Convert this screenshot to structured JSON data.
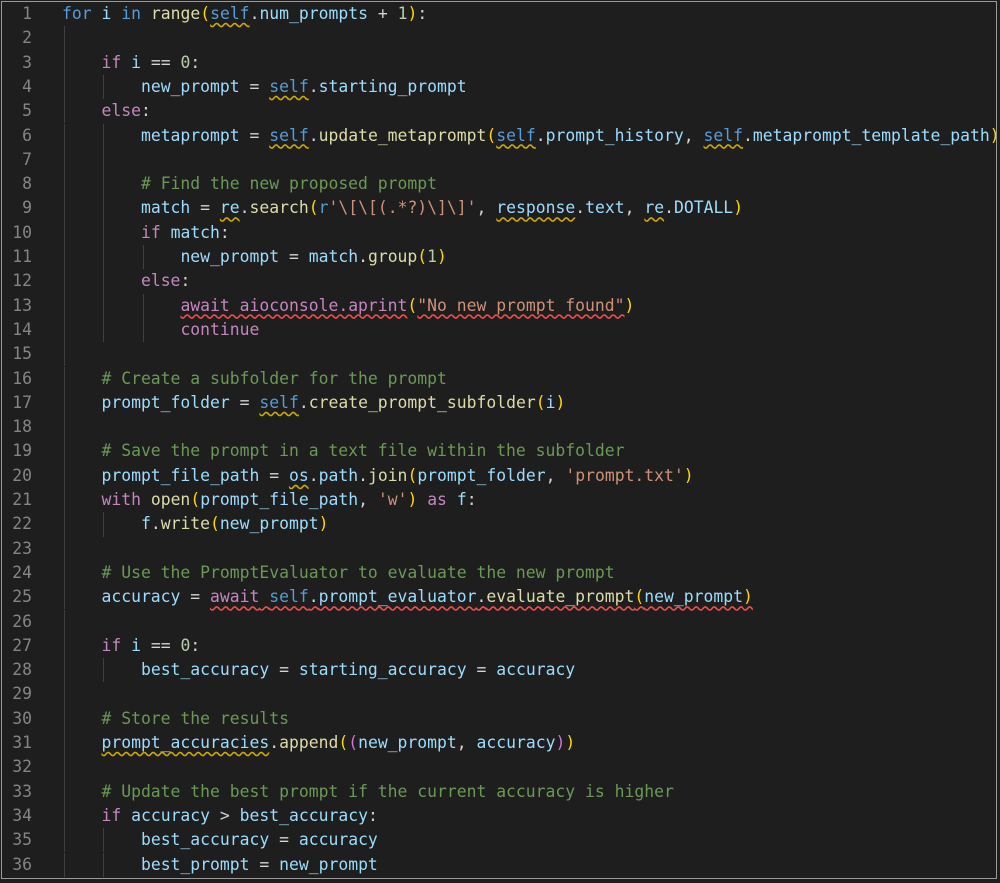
{
  "editor": {
    "theme": "dark",
    "line_count": 36,
    "colors": {
      "background": "#1e1e1e",
      "line_number": "#858585",
      "keyword": "#569cd6",
      "control": "#c586c0",
      "function": "#dcdcaa",
      "variable": "#9cdcfe",
      "string": "#ce9178",
      "number": "#b5cea8",
      "comment": "#6a9955",
      "bracket_1": "#ffd700",
      "bracket_2": "#da70d6",
      "bracket_3": "#179fff",
      "warning_squiggle": "#cca700",
      "error_squiggle": "#f14c4c"
    }
  },
  "lines": [
    {
      "n": "1",
      "indent": 0,
      "tokens": [
        [
          "kw",
          "for"
        ],
        [
          "op",
          " "
        ],
        [
          "vr",
          "i"
        ],
        [
          "op",
          " "
        ],
        [
          "kw",
          "in"
        ],
        [
          "op",
          " "
        ],
        [
          "fn",
          "range"
        ],
        [
          "b1",
          "("
        ],
        [
          "sf",
          "self",
          "sq-y"
        ],
        [
          "op",
          "."
        ],
        [
          "vr",
          "num_prompts"
        ],
        [
          "op",
          " + "
        ],
        [
          "num",
          "1"
        ],
        [
          "b1",
          ")"
        ],
        [
          "op",
          ":"
        ]
      ]
    },
    {
      "n": "2",
      "indent": 1,
      "tokens": []
    },
    {
      "n": "3",
      "indent": 1,
      "tokens": [
        [
          "ctl",
          "if"
        ],
        [
          "op",
          " "
        ],
        [
          "vr",
          "i"
        ],
        [
          "op",
          " == "
        ],
        [
          "num",
          "0"
        ],
        [
          "op",
          ":"
        ]
      ]
    },
    {
      "n": "4",
      "indent": 2,
      "tokens": [
        [
          "vr",
          "new_prompt"
        ],
        [
          "op",
          " = "
        ],
        [
          "sf",
          "self",
          "sq-y"
        ],
        [
          "op",
          "."
        ],
        [
          "vr",
          "starting_prompt"
        ]
      ]
    },
    {
      "n": "5",
      "indent": 1,
      "tokens": [
        [
          "ctl",
          "else"
        ],
        [
          "op",
          ":"
        ]
      ]
    },
    {
      "n": "6",
      "indent": 2,
      "tokens": [
        [
          "vr",
          "metaprompt"
        ],
        [
          "op",
          " = "
        ],
        [
          "sf",
          "self",
          "sq-y"
        ],
        [
          "op",
          "."
        ],
        [
          "fn",
          "update_metaprompt"
        ],
        [
          "b1",
          "("
        ],
        [
          "sf",
          "self",
          "sq-y"
        ],
        [
          "op",
          "."
        ],
        [
          "vr",
          "prompt_history"
        ],
        [
          "op",
          ", "
        ],
        [
          "sf",
          "self",
          "sq-y"
        ],
        [
          "op",
          "."
        ],
        [
          "vr",
          "metaprompt_template_path"
        ],
        [
          "b1",
          ")"
        ]
      ]
    },
    {
      "n": "7",
      "indent": 2,
      "tokens": []
    },
    {
      "n": "8",
      "indent": 2,
      "tokens": [
        [
          "cm",
          "# Find the new proposed prompt"
        ]
      ]
    },
    {
      "n": "9",
      "indent": 2,
      "tokens": [
        [
          "vr",
          "match"
        ],
        [
          "op",
          " = "
        ],
        [
          "vr",
          "re",
          "sq-y"
        ],
        [
          "op",
          "."
        ],
        [
          "fn",
          "search"
        ],
        [
          "b1",
          "("
        ],
        [
          "kw",
          "r"
        ],
        [
          "str",
          "'\\[\\[(.*?)\\]\\]'"
        ],
        [
          "op",
          ", "
        ],
        [
          "vr",
          "response",
          "sq-y"
        ],
        [
          "op",
          "."
        ],
        [
          "vr",
          "text"
        ],
        [
          "op",
          ", "
        ],
        [
          "vr",
          "re",
          "sq-y"
        ],
        [
          "op",
          "."
        ],
        [
          "vr",
          "DOTALL"
        ],
        [
          "b1",
          ")"
        ]
      ]
    },
    {
      "n": "10",
      "indent": 2,
      "tokens": [
        [
          "ctl",
          "if"
        ],
        [
          "op",
          " "
        ],
        [
          "vr",
          "match"
        ],
        [
          "op",
          ":"
        ]
      ]
    },
    {
      "n": "11",
      "indent": 3,
      "tokens": [
        [
          "vr",
          "new_prompt"
        ],
        [
          "op",
          " = "
        ],
        [
          "vr",
          "match"
        ],
        [
          "op",
          "."
        ],
        [
          "fn",
          "group"
        ],
        [
          "b1",
          "("
        ],
        [
          "num",
          "1"
        ],
        [
          "b1",
          ")"
        ]
      ]
    },
    {
      "n": "12",
      "indent": 2,
      "tokens": [
        [
          "ctl",
          "else"
        ],
        [
          "op",
          ":"
        ]
      ]
    },
    {
      "n": "13",
      "indent": 3,
      "tokens": [
        [
          "ctl",
          "await aioconsole.aprint",
          "sq-r"
        ],
        [
          "b1",
          "("
        ],
        [
          "str",
          "\"No new prompt found\"",
          "sq-r"
        ],
        [
          "b1",
          ")"
        ]
      ]
    },
    {
      "n": "14",
      "indent": 3,
      "tokens": [
        [
          "ctl",
          "continue"
        ]
      ]
    },
    {
      "n": "15",
      "indent": 1,
      "tokens": []
    },
    {
      "n": "16",
      "indent": 1,
      "tokens": [
        [
          "cm",
          "# Create a subfolder for the prompt"
        ]
      ]
    },
    {
      "n": "17",
      "indent": 1,
      "tokens": [
        [
          "vr",
          "prompt_folder"
        ],
        [
          "op",
          " = "
        ],
        [
          "sf",
          "self",
          "sq-y"
        ],
        [
          "op",
          "."
        ],
        [
          "fn",
          "create_prompt_subfolder"
        ],
        [
          "b1",
          "("
        ],
        [
          "vr",
          "i"
        ],
        [
          "b1",
          ")"
        ]
      ]
    },
    {
      "n": "18",
      "indent": 1,
      "tokens": []
    },
    {
      "n": "19",
      "indent": 1,
      "tokens": [
        [
          "cm",
          "# Save the prompt in a text file within the subfolder"
        ]
      ]
    },
    {
      "n": "20",
      "indent": 1,
      "tokens": [
        [
          "vr",
          "prompt_file_path"
        ],
        [
          "op",
          " = "
        ],
        [
          "vr",
          "os",
          "sq-y"
        ],
        [
          "op",
          "."
        ],
        [
          "vr",
          "path"
        ],
        [
          "op",
          "."
        ],
        [
          "fn",
          "join"
        ],
        [
          "b1",
          "("
        ],
        [
          "vr",
          "prompt_folder"
        ],
        [
          "op",
          ", "
        ],
        [
          "str",
          "'prompt.txt'"
        ],
        [
          "b1",
          ")"
        ]
      ]
    },
    {
      "n": "21",
      "indent": 1,
      "tokens": [
        [
          "ctl",
          "with"
        ],
        [
          "op",
          " "
        ],
        [
          "fn",
          "open"
        ],
        [
          "b1",
          "("
        ],
        [
          "vr",
          "prompt_file_path"
        ],
        [
          "op",
          ", "
        ],
        [
          "str",
          "'w'"
        ],
        [
          "b1",
          ")"
        ],
        [
          "op",
          " "
        ],
        [
          "ctl",
          "as"
        ],
        [
          "op",
          " "
        ],
        [
          "vr",
          "f"
        ],
        [
          "op",
          ":"
        ]
      ]
    },
    {
      "n": "22",
      "indent": 2,
      "tokens": [
        [
          "vr",
          "f"
        ],
        [
          "op",
          "."
        ],
        [
          "fn",
          "write"
        ],
        [
          "b1",
          "("
        ],
        [
          "vr",
          "new_prompt"
        ],
        [
          "b1",
          ")"
        ]
      ]
    },
    {
      "n": "23",
      "indent": 1,
      "tokens": []
    },
    {
      "n": "24",
      "indent": 1,
      "tokens": [
        [
          "cm",
          "# Use the PromptEvaluator to evaluate the new prompt"
        ]
      ]
    },
    {
      "n": "25",
      "indent": 1,
      "tokens": [
        [
          "vr",
          "accuracy"
        ],
        [
          "op",
          " = "
        ],
        [
          "ctl",
          "await",
          "sq-r"
        ],
        [
          "op",
          " ",
          "sq-r"
        ],
        [
          "sf",
          "self",
          "sq-r"
        ],
        [
          "op",
          ".",
          "sq-r"
        ],
        [
          "vr",
          "prompt_evaluator",
          "sq-r"
        ],
        [
          "op",
          ".",
          "sq-r"
        ],
        [
          "fn",
          "evaluate_prompt",
          "sq-r"
        ],
        [
          "b1",
          "(",
          "sq-r"
        ],
        [
          "vr",
          "new_prompt",
          "sq-r"
        ],
        [
          "b1",
          ")",
          "sq-r"
        ]
      ]
    },
    {
      "n": "26",
      "indent": 1,
      "tokens": []
    },
    {
      "n": "27",
      "indent": 1,
      "tokens": [
        [
          "ctl",
          "if"
        ],
        [
          "op",
          " "
        ],
        [
          "vr",
          "i"
        ],
        [
          "op",
          " == "
        ],
        [
          "num",
          "0"
        ],
        [
          "op",
          ":"
        ]
      ]
    },
    {
      "n": "28",
      "indent": 2,
      "tokens": [
        [
          "vr",
          "best_accuracy"
        ],
        [
          "op",
          " = "
        ],
        [
          "vr",
          "starting_accuracy"
        ],
        [
          "op",
          " = "
        ],
        [
          "vr",
          "accuracy"
        ]
      ]
    },
    {
      "n": "29",
      "indent": 1,
      "tokens": []
    },
    {
      "n": "30",
      "indent": 1,
      "tokens": [
        [
          "cm",
          "# Store the results"
        ]
      ]
    },
    {
      "n": "31",
      "indent": 1,
      "tokens": [
        [
          "vr",
          "prompt_accuracies",
          "sq-y"
        ],
        [
          "op",
          "."
        ],
        [
          "fn",
          "append"
        ],
        [
          "b1",
          "("
        ],
        [
          "b2",
          "("
        ],
        [
          "vr",
          "new_prompt"
        ],
        [
          "op",
          ", "
        ],
        [
          "vr",
          "accuracy"
        ],
        [
          "b2",
          ")"
        ],
        [
          "b1",
          ")"
        ]
      ]
    },
    {
      "n": "32",
      "indent": 1,
      "tokens": []
    },
    {
      "n": "33",
      "indent": 1,
      "tokens": [
        [
          "cm",
          "# Update the best prompt if the current accuracy is higher"
        ]
      ]
    },
    {
      "n": "34",
      "indent": 1,
      "tokens": [
        [
          "ctl",
          "if"
        ],
        [
          "op",
          " "
        ],
        [
          "vr",
          "accuracy"
        ],
        [
          "op",
          " > "
        ],
        [
          "vr",
          "best_accuracy"
        ],
        [
          "op",
          ":"
        ]
      ]
    },
    {
      "n": "35",
      "indent": 2,
      "tokens": [
        [
          "vr",
          "best_accuracy"
        ],
        [
          "op",
          " = "
        ],
        [
          "vr",
          "accuracy"
        ]
      ]
    },
    {
      "n": "36",
      "indent": 2,
      "tokens": [
        [
          "vr",
          "best_prompt"
        ],
        [
          "op",
          " = "
        ],
        [
          "vr",
          "new_prompt"
        ]
      ]
    }
  ]
}
